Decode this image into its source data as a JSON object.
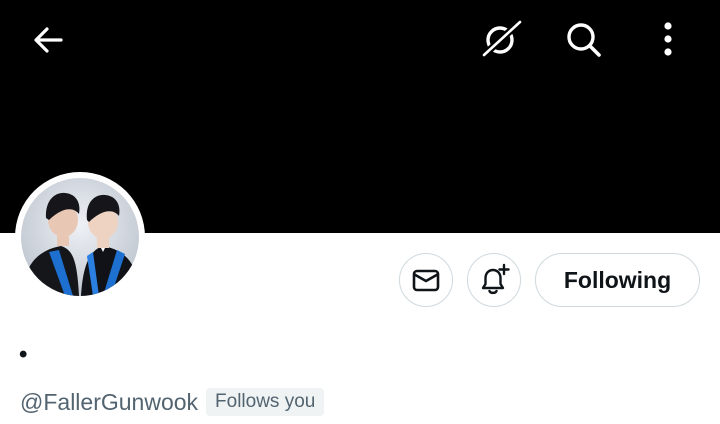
{
  "profile": {
    "display_name": "•",
    "handle": "@FallerGunwook",
    "follows_you_label": "Follows you"
  },
  "actions": {
    "follow_label": "Following"
  },
  "icons": {
    "back": "back-arrow-icon",
    "grok": "grok-icon",
    "search": "search-icon",
    "more": "more-vertical-icon",
    "message": "envelope-icon",
    "notifications": "bell-plus-icon"
  },
  "colors": {
    "banner": "#000000",
    "text_primary": "#0f1419",
    "text_secondary": "#536471",
    "border": "#cfd9de",
    "badge_bg": "#eff3f4"
  }
}
